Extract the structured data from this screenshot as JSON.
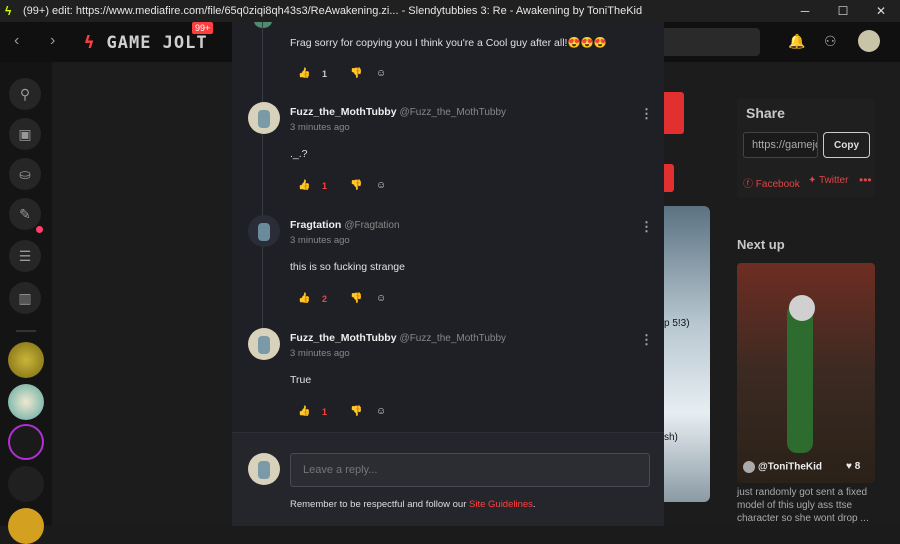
{
  "window": {
    "title": "(99+) edit: https://www.mediafire.com/file/65q0ziqi8qh43s3/ReAwakening.zi... - Slendytubbies 3: Re - Awakening by ToniTheKid",
    "minimize": "─",
    "maximize": "☐",
    "close": "✕"
  },
  "topnav": {
    "back": "‹",
    "forward": "›",
    "logo": "GAME JOLT",
    "logo_bolt": "ϟ",
    "badge": "99+",
    "bell_icon": "🔔",
    "friends_icon": "⚇"
  },
  "sidebar": {
    "items": [
      {
        "name": "library",
        "glyph": "⚲"
      },
      {
        "name": "store",
        "glyph": "▣"
      },
      {
        "name": "inventory",
        "glyph": "⛀"
      },
      {
        "name": "posts",
        "glyph": "✎"
      },
      {
        "name": "chat",
        "glyph": "☰"
      },
      {
        "name": "activity",
        "glyph": "▥"
      }
    ]
  },
  "share": {
    "title": "Share",
    "url": "https://gamejolt.com",
    "copy": "Copy",
    "facebook": "Facebook",
    "twitter": "Twitter",
    "more": "•••"
  },
  "next_up": {
    "title": "Next up",
    "user": "@ToniTheKid",
    "likes": "8",
    "desc": "just randomly got sent a fixed model of this ugly ass ttse character so she wont drop ..."
  },
  "background": {
    "video_text_1": "p 5!3)",
    "video_text_2": "sh)"
  },
  "comments": {
    "top": {
      "text": "Frag sorry for copying you I think you're a Cool guy after all!😍😍😍",
      "likes": "1",
      "liked": false
    },
    "items": [
      {
        "name": "Fuzz_the_MothTubby",
        "handle": "@Fuzz_the_MothTubby",
        "time": "3 minutes ago",
        "text": "._.?",
        "likes": "1",
        "liked": true
      },
      {
        "name": "Fragtation",
        "handle": "@Fragtation",
        "time": "3 minutes ago",
        "text": "this is so fucking strange",
        "likes": "2",
        "liked": true
      },
      {
        "name": "Fuzz_the_MothTubby",
        "handle": "@Fuzz_the_MothTubby",
        "time": "3 minutes ago",
        "text": "True",
        "likes": "1",
        "liked": true
      }
    ],
    "menu": "⋮",
    "like_icon": "👍",
    "dislike_icon": "👎",
    "react_icon": "☺"
  },
  "reply": {
    "placeholder": "Leave a reply...",
    "note_prefix": "Remember to be respectful and follow our ",
    "note_link": "Site Guidelines",
    "note_suffix": "."
  },
  "colors": {
    "accent": "#ff4040",
    "modal_bg": "#1f2026"
  }
}
